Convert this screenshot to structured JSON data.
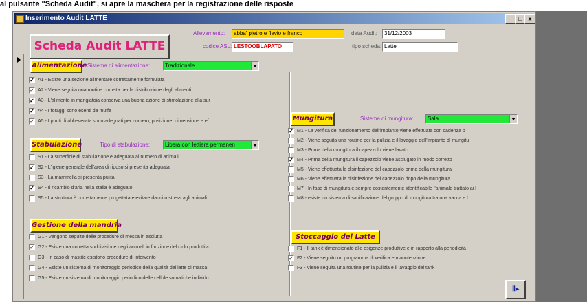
{
  "caption_strip": {
    "prefix": "al pulsante \"Scheda Audit\", si apre la",
    "bold": " maschera per la registrazione delle risposte"
  },
  "window": {
    "title": "Inserimento Audit LATTE",
    "min": "_",
    "max": "□",
    "close": "x"
  },
  "header": {
    "title_button": "Scheda Audit LATTE",
    "allevamento_label": "Allevamento:",
    "allevamento_value": "abba' pietro e flavio e franco",
    "asl_label": "codice ASL:",
    "asl_value": "LESTOOBLAPATO",
    "data_label": "data Audit:",
    "data_value": "31/12/2003",
    "tipo_label": "tipo scheda:",
    "tipo_value": "Latte"
  },
  "alimentazione": {
    "title": "Alimentazione",
    "sistema_label": "Sistema di alimentazione:",
    "sistema_value": "Tradizionale",
    "items": [
      {
        "text": "A1 - Esiste una sezione alimentare correttamente formulata",
        "checked": true
      },
      {
        "text": "A2 - Viene seguita una routine corretta per la distribuzione degli alimenti",
        "checked": true
      },
      {
        "text": "A3 - L'alimento in mangiatoia conserva una buona azione di stimolazione alla sur",
        "checked": true
      },
      {
        "text": "A4 - I foraggi sono esenti da muffe",
        "checked": true
      },
      {
        "text": "A5 - I punti di abbeverata sono adeguati per numero, posizione, dimensione e ef",
        "checked": true
      }
    ]
  },
  "stabulazione": {
    "title": "Stabulazione",
    "tipo_label": "Tipo di stabulazione:",
    "tipo_value": "Libera con lettiera permanen",
    "items": [
      {
        "text": "S1 - La superficie di stabulazione è adeguata al numero di animali",
        "checked": false
      },
      {
        "text": "S2 - L'igiene generale dell'area di riposo si presenta adeguata",
        "checked": true
      },
      {
        "text": "S3 - La mammella si presenta pulita",
        "checked": false
      },
      {
        "text": "S4 - Il ricambio d'aria nella stalla è adeguato",
        "checked": true
      },
      {
        "text": "S5 - La struttura è correttamente progettata e evitare danni o stress agli animali",
        "checked": false
      }
    ]
  },
  "gestione": {
    "title": "Gestione della mandria",
    "items": [
      {
        "text": "G1 - Vengono seguite delle procedure di messa in asciutta",
        "checked": false
      },
      {
        "text": "G2 - Esiste una corretta suddivisione degli animali in funzione del ciclo produttivo",
        "checked": true
      },
      {
        "text": "G3 - In caso di mastite esistono procedure di intervento",
        "checked": false
      },
      {
        "text": "G4 - Esiste un sistema di monitoraggio periodico della qualità del latte di massa",
        "checked": false
      },
      {
        "text": "G5 - Esiste un sistema di monitoraggio periodico delle cellule somatiche individu",
        "checked": false
      }
    ]
  },
  "mungitura": {
    "title": "Mungitura",
    "sistema_label": "Sistema di mungitura:",
    "sistema_value": "Sala",
    "items": [
      {
        "text": "M1 - La verifica del funzionamento dell'impianto viene effettuata con cadenza p",
        "checked": true
      },
      {
        "text": "M2 - Viene seguita una routine per la pulizia e il lavaggio dell'impianto di mungitu",
        "checked": false
      },
      {
        "text": "M3 - Prima della mungitura il capezzolo viene lavato",
        "checked": false
      },
      {
        "text": "M4 - Prima della mungitura il capezzolo viene asciugato in modo corretto",
        "checked": true
      },
      {
        "text": "M5 - Viene effettuata la disinfezione del capezzolo prima della mungitura",
        "checked": false
      },
      {
        "text": "M6 - Viene effettuata la disinfezione del capezzolo dopo della mungitura",
        "checked": false
      },
      {
        "text": "M7 - In fase di mungitura è sempre costantemente identificabile l'animale trattato ai l",
        "checked": false
      },
      {
        "text": "M8 - esiste un sistema di sanificazione del gruppo di mungitura tra una vacca e l",
        "checked": false
      }
    ]
  },
  "stoccaggio": {
    "title": "Stoccaggio del Latte",
    "items": [
      {
        "text": "F1 - Il tank è dimensionato alle esigenze produttive e in rapporto alla periodicità",
        "checked": false
      },
      {
        "text": "F2 - Viene seguito un programma di verifica e manutenzione",
        "checked": true
      },
      {
        "text": "F3 - Viene seguita una routine per la pulizia e il lavaggio del tank",
        "checked": false
      }
    ]
  },
  "exit_button": {
    "label": "Ⅱ▸"
  }
}
